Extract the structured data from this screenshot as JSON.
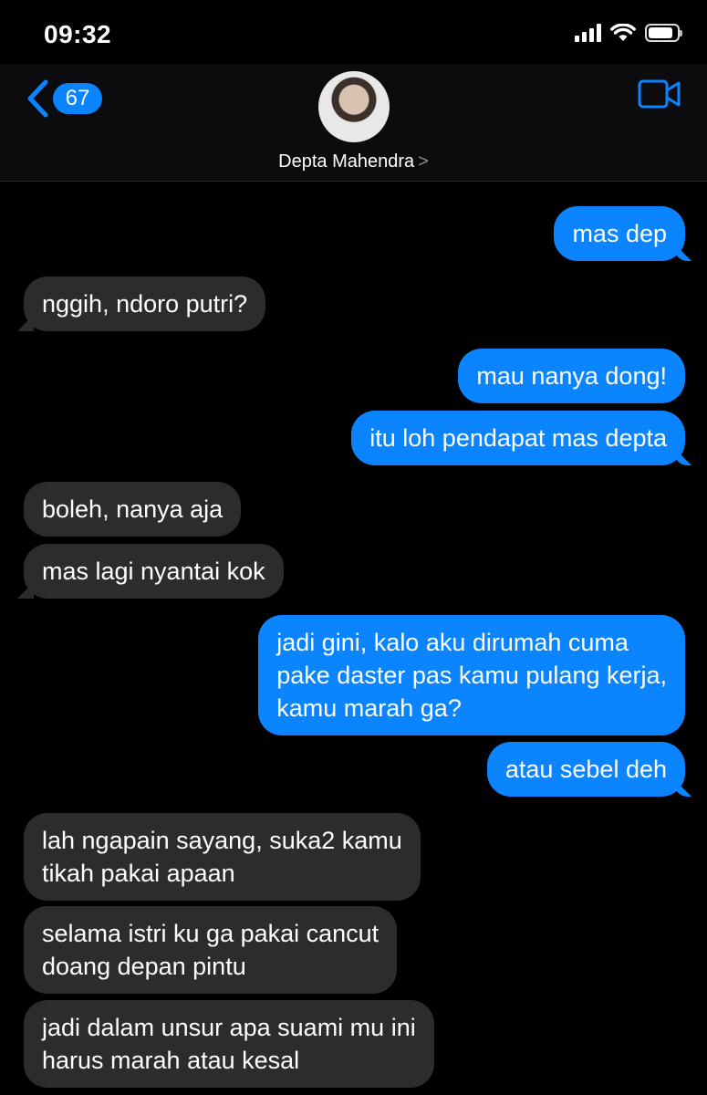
{
  "status_bar": {
    "time": "09:32",
    "battery_level": 0.85
  },
  "header": {
    "unread_count": "67",
    "contact_name": "Depta Mahendra",
    "icons": {
      "back": "chevron-left-icon",
      "video": "video-camera-icon",
      "disclosure": "chevron-right-icon"
    }
  },
  "colors": {
    "sent_bubble": "#0a84ff",
    "received_bubble": "#2c2c2e",
    "background": "#000000"
  },
  "messages": [
    {
      "side": "sent",
      "text": "mas dep"
    },
    {
      "side": "received",
      "text": "nggih, ndoro putri?"
    },
    {
      "side": "sent",
      "text": "mau nanya dong!"
    },
    {
      "side": "sent",
      "text": "itu loh pendapat mas depta"
    },
    {
      "side": "received",
      "text": "boleh, nanya aja"
    },
    {
      "side": "received",
      "text": "mas lagi nyantai kok"
    },
    {
      "side": "sent",
      "text": "jadi gini, kalo aku dirumah cuma\npake daster pas kamu pulang kerja,\nkamu marah ga?"
    },
    {
      "side": "sent",
      "text": "atau sebel deh"
    },
    {
      "side": "received",
      "text": "lah ngapain sayang, suka2 kamu\ntikah pakai apaan"
    },
    {
      "side": "received",
      "text": "selama istri ku ga pakai cancut\ndoang depan pintu"
    },
    {
      "side": "received",
      "text": "jadi dalam unsur apa suami mu ini\nharus marah atau kesal"
    }
  ]
}
